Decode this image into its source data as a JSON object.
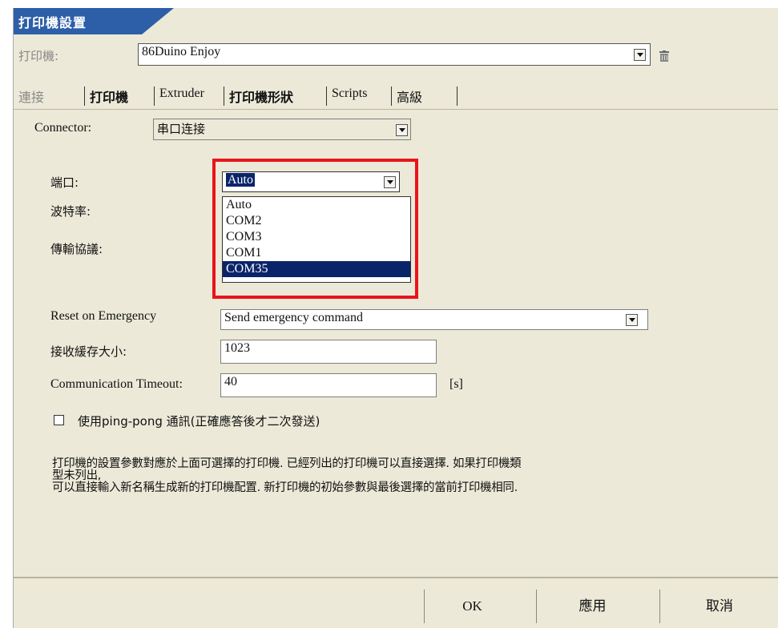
{
  "window": {
    "title": "打印機設置"
  },
  "printer": {
    "label": "打印機:",
    "value": "86Duino Enjoy"
  },
  "tabs": [
    "連接",
    "打印機",
    "Extruder",
    "打印機形狀",
    "Scripts",
    "高級"
  ],
  "connector": {
    "label": "Connector:",
    "value": "串口连接"
  },
  "port": {
    "label": "端口:",
    "value": "Auto",
    "options": [
      "Auto",
      "COM2",
      "COM3",
      "COM1",
      "COM35"
    ],
    "highlighted": "COM35"
  },
  "baud": {
    "label": "波特率:"
  },
  "protocol": {
    "label": "傳輸協議:"
  },
  "reset": {
    "label": "Reset on Emergency",
    "value": "Send emergency command"
  },
  "receive_cache": {
    "label": "接收緩存大小:",
    "value": "1023"
  },
  "timeout": {
    "label": "Communication Timeout:",
    "value": "40",
    "unit": "[s]"
  },
  "pingpong": {
    "label": "使用ping-pong 通訊(正確應答後才二次發送)",
    "checked": false
  },
  "help": {
    "line1": "打印機的設置參數對應於上面可選擇的打印機. 已經列出的打印機可以直接選擇. 如果打印機類",
    "line2": "型未列出,",
    "line3": "可以直接輸入新名稱生成新的打印機配置. 新打印機的初始參數與最後選擇的當前打印機相同."
  },
  "buttons": {
    "ok": "OK",
    "apply": "應用",
    "cancel": "取消"
  },
  "colors": {
    "title_bar": "#2d5fa8",
    "selection": "#0a246a",
    "highlight_box": "#e8141a"
  }
}
